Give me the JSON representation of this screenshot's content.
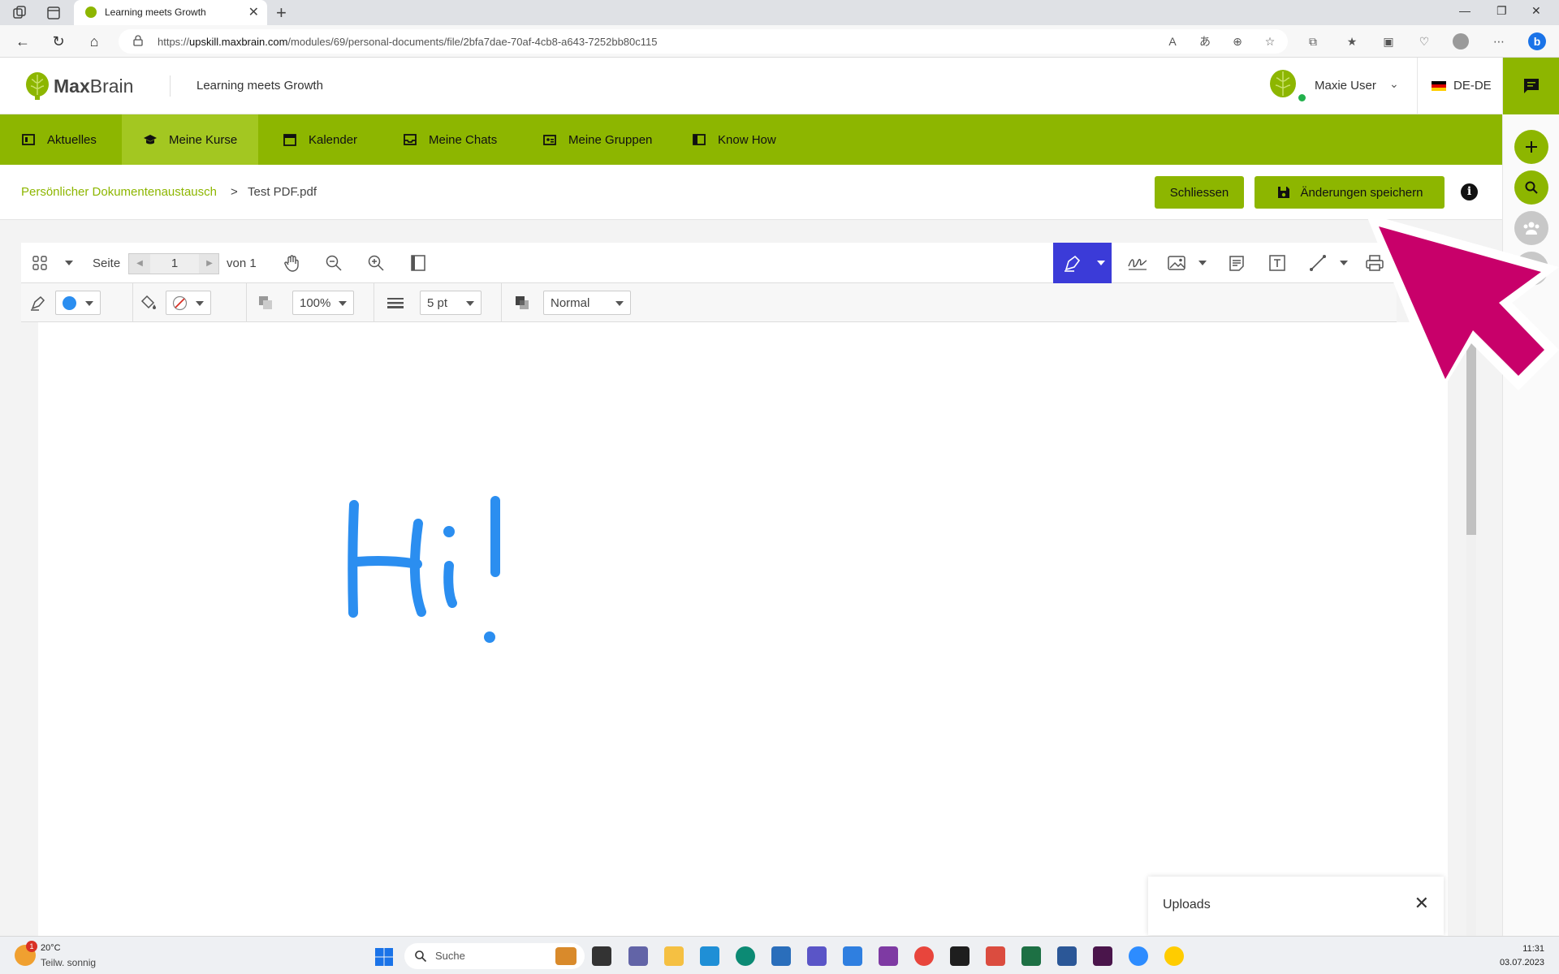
{
  "browser": {
    "tab_title": "Learning meets Growth",
    "url_prefix": "https://",
    "url_domain": "upskill.maxbrain.com",
    "url_path": "/modules/69/personal-documents/file/2bfa7dae-70af-4cb8-a643-7252bb80c115"
  },
  "header": {
    "logo_bold": "Max",
    "logo_light": "Brain",
    "tagline": "Learning meets Growth",
    "user_name": "Maxie User",
    "language": "DE-DE"
  },
  "nav": {
    "items": [
      {
        "label": "Aktuelles",
        "icon": "news-icon",
        "active": false
      },
      {
        "label": "Meine Kurse",
        "icon": "graduation-cap-icon",
        "active": true
      },
      {
        "label": "Kalender",
        "icon": "calendar-icon",
        "active": false
      },
      {
        "label": "Meine Chats",
        "icon": "inbox-icon",
        "active": false
      },
      {
        "label": "Meine Gruppen",
        "icon": "groups-icon",
        "active": false
      },
      {
        "label": "Know How",
        "icon": "book-icon",
        "active": false
      }
    ]
  },
  "breadcrumb": {
    "parent": "Persönlicher Dokumentenaustausch",
    "separator": ">",
    "current": "Test PDF.pdf"
  },
  "actions": {
    "close_label": "Schliessen",
    "save_label": "Änderungen speichern"
  },
  "viewer": {
    "page_label": "Seite",
    "page_current": "1",
    "page_total_label": "von 1",
    "opacity_value": "100%",
    "stroke_value": "5 pt",
    "blend_value": "Normal",
    "stroke_color": "#2b8ef0",
    "active_tool_color": "#3b3bd8",
    "drawing_text": "Hi!"
  },
  "uploads": {
    "label": "Uploads"
  },
  "taskbar": {
    "weather_temp": "20°C",
    "weather_text": "Teilw. sonnig",
    "weather_badge": "1",
    "search_label": "Suche",
    "time": "11:31",
    "date": "03.07.2023"
  },
  "colors": {
    "brand": "#8db600",
    "pointer": "#c8006a"
  }
}
